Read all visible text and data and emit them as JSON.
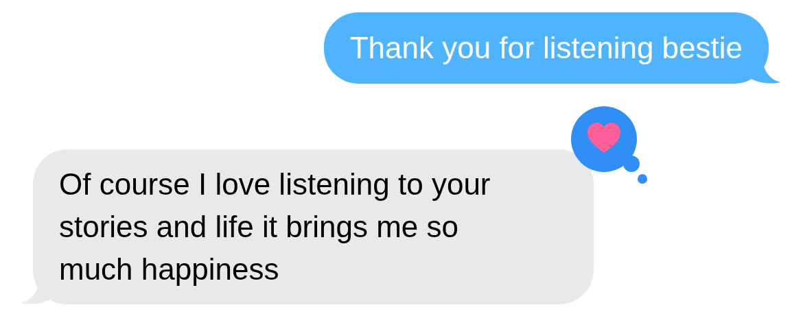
{
  "messages": [
    {
      "kind": "sent",
      "text": "Thank you for listening bestie"
    },
    {
      "kind": "received",
      "text": "Of course I love listening to your stories and life it brings me so much happiness",
      "reaction": {
        "kind": "heart"
      }
    }
  ]
}
